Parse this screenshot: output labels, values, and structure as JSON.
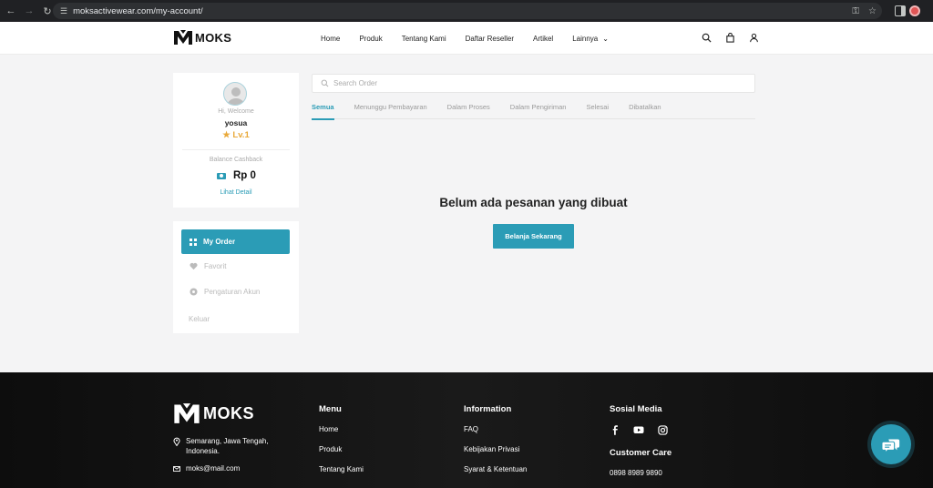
{
  "browser": {
    "url": "moksactivewear.com/my-account/"
  },
  "header": {
    "brand": "MOKS",
    "nav": [
      {
        "label": "Home"
      },
      {
        "label": "Produk"
      },
      {
        "label": "Tentang Kami"
      },
      {
        "label": "Daftar Reseller"
      },
      {
        "label": "Artikel"
      },
      {
        "label": "Lainnya"
      }
    ],
    "icons": [
      "search-icon",
      "bag-icon",
      "user-icon"
    ]
  },
  "profile": {
    "greeting": "Hi, Welcome",
    "username": "yosua",
    "level": "Lv.1",
    "balance_label": "Balance Cashback",
    "balance_amount": "Rp 0",
    "detail_link": "Lihat Detail"
  },
  "side_menu": {
    "items": [
      {
        "label": "My Order",
        "icon": "grid-icon",
        "active": true
      },
      {
        "label": "Favorit",
        "icon": "heart-icon",
        "active": false
      },
      {
        "label": "Pengaturan Akun",
        "icon": "settings-icon",
        "active": false
      }
    ],
    "logout": "Keluar"
  },
  "orders": {
    "search_placeholder": "Search Order",
    "tabs": [
      {
        "label": "Semua",
        "active": true
      },
      {
        "label": "Menunggu Pembayaran",
        "active": false
      },
      {
        "label": "Dalam Proses",
        "active": false
      },
      {
        "label": "Dalam Pengiriman",
        "active": false
      },
      {
        "label": "Selesai",
        "active": false
      },
      {
        "label": "Dibatalkan",
        "active": false
      }
    ],
    "empty_message": "Belum ada pesanan yang dibuat",
    "shop_button": "Belanja Sekarang"
  },
  "footer": {
    "brand": "MOKS",
    "address": "Semarang, Jawa Tengah, Indonesia.",
    "email": "moks@mail.com",
    "menu_title": "Menu",
    "menu_links": [
      "Home",
      "Produk",
      "Tentang Kami"
    ],
    "info_title": "Information",
    "info_links": [
      "FAQ",
      "Kebijakan Privasi",
      "Syarat & Ketentuan"
    ],
    "social_title": "Sosial Media",
    "social_icons": [
      "facebook-icon",
      "youtube-icon",
      "instagram-icon"
    ],
    "care_title": "Customer Care",
    "phone": "0898 8989 9890"
  },
  "colors": {
    "accent": "#2b9cb6",
    "level": "#e9a93a",
    "footer_bg": "#111111"
  }
}
